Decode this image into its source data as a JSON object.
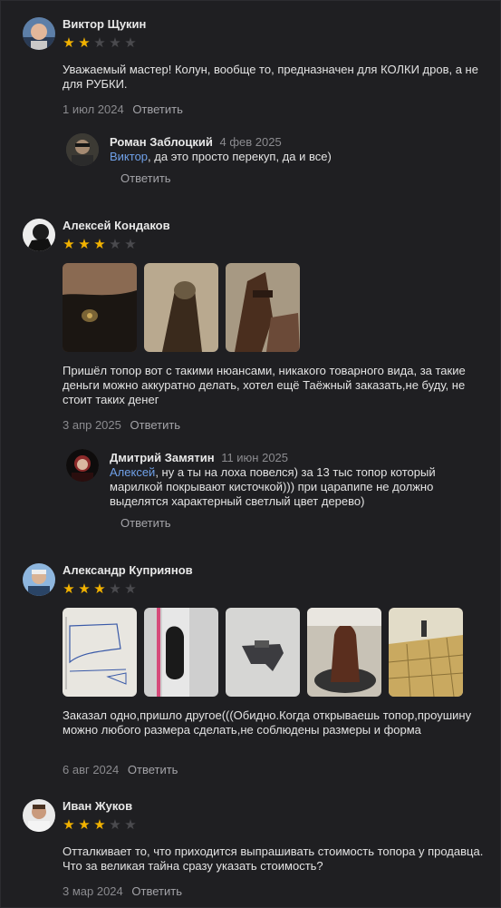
{
  "reviews": [
    {
      "author": "Виктор Щукин",
      "rating": 2,
      "text": "Уважаемый мастер! Колун, вообще то, предназначен для КОЛКИ дров, а не для РУБКИ.",
      "date": "1 июл 2024",
      "reply_label": "Ответить",
      "replies": [
        {
          "author": "Роман Заблоцкий",
          "date": "4 фев 2025",
          "mention": "Виктор",
          "text": ", да это просто перекуп, да и все)",
          "reply_label": "Ответить"
        }
      ]
    },
    {
      "author": "Алексей Кондаков",
      "rating": 3,
      "text": "Пришёл топор вот с такими нюансами, никакого товарного вида, за такие деньги можно аккуратно делать, хотел ещё Таёжный заказать,не буду, не стоит таких денег",
      "date": "3 апр 2025",
      "reply_label": "Ответить",
      "replies": [
        {
          "author": "Дмитрий Замятин",
          "date": "11 июн 2025",
          "mention": "Алексей",
          "text": ", ну а ты на лоха повелся) за 13 тыс топор который марилкой покрывают кисточкой))) при царапипе не должно выделятся характерный светлый цвет дерево)",
          "reply_label": "Ответить"
        }
      ]
    },
    {
      "author": "Александр Куприянов",
      "rating": 3,
      "text": "Заказал одно,пришло другое(((Обидно.Когда открываешь топор,проушину можно любого размера сделать,не соблюдены размеры и форма",
      "date": "6 авг 2024",
      "reply_label": "Ответить"
    },
    {
      "author": "Иван Жуков",
      "rating": 3,
      "text": "Отталкивает то, что приходится выпрашивать стоимость топора у продавца. Что за великая тайна сразу указать стоимость?",
      "date": "3 мар 2024",
      "reply_label": "Ответить"
    }
  ],
  "colors": {
    "background": "#1f1f22",
    "star_on": "#f2b200",
    "star_off": "#4a4a4e",
    "mention": "#6fa0e8",
    "meta": "#8b8b8f"
  }
}
